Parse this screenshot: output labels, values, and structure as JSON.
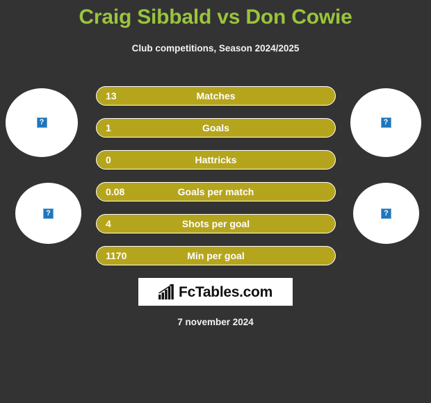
{
  "header": {
    "title": "Craig Sibbald vs Don Cowie",
    "subtitle": "Club competitions, Season 2024/2025",
    "title_color": "#9ac43c"
  },
  "players": {
    "home": {
      "name": "Craig Sibbald",
      "avatar_top": "broken-image-placeholder",
      "avatar_bottom": "broken-image-placeholder"
    },
    "away": {
      "name": "Don Cowie",
      "avatar_top": "broken-image-placeholder",
      "avatar_bottom": "broken-image-placeholder"
    },
    "placeholder_glyph": "?"
  },
  "stats": [
    {
      "value": "13",
      "label": "Matches"
    },
    {
      "value": "1",
      "label": "Goals"
    },
    {
      "value": "0",
      "label": "Hattricks"
    },
    {
      "value": "0.08",
      "label": "Goals per match"
    },
    {
      "value": "4",
      "label": "Shots per goal"
    },
    {
      "value": "1170",
      "label": "Min per goal"
    }
  ],
  "footer": {
    "logo_text": "FcTables.com",
    "logo_icon": "bar-chart-growth-icon",
    "date": "7 november 2024"
  },
  "theme": {
    "background": "#333333",
    "bar_fill": "#b5a51c",
    "bar_border": "#ffffff",
    "text": "#ffffff",
    "accent": "#9ac43c"
  },
  "chart_data": {
    "type": "bar",
    "title": "Craig Sibbald vs Don Cowie",
    "subtitle": "Club competitions, Season 2024/2025",
    "categories": [
      "Matches",
      "Goals",
      "Hattricks",
      "Goals per match",
      "Shots per goal",
      "Min per goal"
    ],
    "values": [
      13,
      1,
      0,
      0.08,
      4,
      1170
    ],
    "value_labels": [
      "13",
      "1",
      "0",
      "0.08",
      "4",
      "1170"
    ],
    "series": [
      {
        "name": "Craig Sibbald",
        "values": [
          13,
          1,
          0,
          0.08,
          4,
          1170
        ]
      }
    ],
    "xlabel": "",
    "ylabel": "",
    "legend": [
      "Craig Sibbald",
      "Don Cowie"
    ],
    "legend_position": "sides",
    "grid": false,
    "orientation": "horizontal",
    "annotation": "7 november 2024"
  }
}
